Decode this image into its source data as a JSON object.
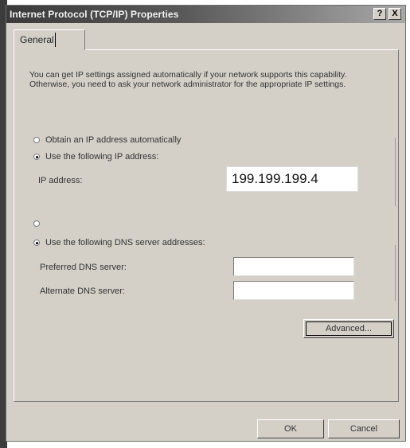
{
  "window": {
    "title": "Internet Protocol (TCP/IP) Properties",
    "help_label": "?",
    "close_label": "X"
  },
  "tabs": [
    {
      "label": "General"
    }
  ],
  "description": "You can get IP settings assigned automatically if your network supports this capability. Otherwise, you need to ask your network administrator for the appropriate IP settings.",
  "ip_section": {
    "obtain_auto_label": "Obtain an IP address automatically",
    "obtain_auto_selected": false,
    "use_following_label": "Use the following IP address:",
    "use_following_selected": true,
    "ip_address_label": "IP address:",
    "ip_address_value": "199.199.199.4"
  },
  "dns_section": {
    "obtain_auto_selected": false,
    "use_following_label": "Use the following DNS server addresses:",
    "use_following_selected": true,
    "preferred_label": "Preferred DNS server:",
    "preferred_value": "",
    "alternate_label": "Alternate DNS server:",
    "alternate_value": ""
  },
  "buttons": {
    "advanced": "Advanced...",
    "ok": "OK",
    "cancel": "Cancel"
  }
}
